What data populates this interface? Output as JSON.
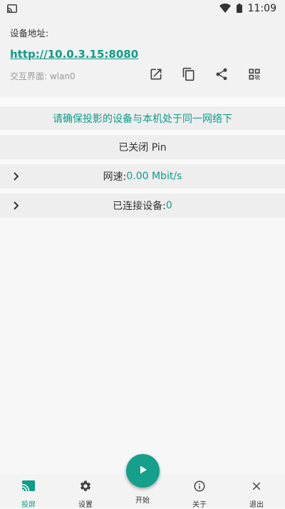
{
  "status_bar": {
    "time": "11:09"
  },
  "header": {
    "address_label": "设备地址:",
    "address_url": "http://10.0.3.15:8080",
    "interface_text": "交互界面: wlan0",
    "actions": [
      {
        "icon": "open-external-icon"
      },
      {
        "icon": "copy-icon"
      },
      {
        "icon": "share-icon"
      },
      {
        "icon": "qr-code-icon"
      }
    ]
  },
  "notice": "请确保投影的设备与本机处于同一网络下",
  "pin_status": "已关闭 Pin",
  "speed": {
    "label": "网速: ",
    "value": "0.00 Mbit/s"
  },
  "connected": {
    "label": "已连接设备: ",
    "value": "0"
  },
  "bottom_nav": [
    {
      "label": "投屏",
      "icon": "cast-icon",
      "active": true
    },
    {
      "label": "设置",
      "icon": "gear-icon",
      "active": false
    },
    {
      "label": "开始",
      "icon": "play-icon",
      "active": false
    },
    {
      "label": "关于",
      "icon": "info-icon",
      "active": false
    },
    {
      "label": "退出",
      "icon": "close-icon",
      "active": false
    }
  ],
  "colors": {
    "accent": "#0f9d88",
    "fab": "#15a08c"
  }
}
